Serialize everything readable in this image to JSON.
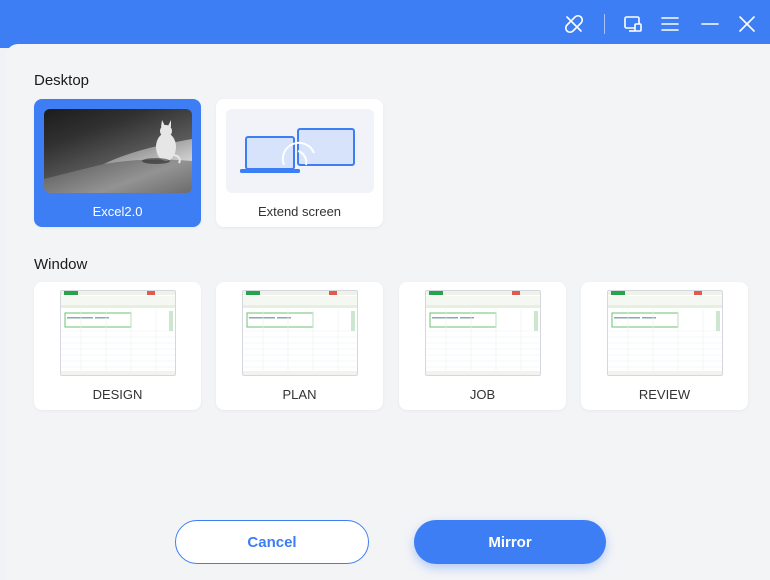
{
  "window": {
    "title_icons": [
      "disconnect-icon",
      "screen-cast-icon",
      "menu-icon",
      "minimize-icon",
      "close-icon"
    ],
    "accent": "#3d7ef5"
  },
  "desktop": {
    "label": "Desktop",
    "items": [
      {
        "label": "Excel2.0",
        "thumbnail": "cat-photo",
        "selected": true
      },
      {
        "label": "Extend screen",
        "thumbnail": "extend-screen",
        "selected": false
      }
    ]
  },
  "window_section": {
    "label": "Window",
    "items": [
      {
        "label": "DESIGN"
      },
      {
        "label": "PLAN"
      },
      {
        "label": "JOB"
      },
      {
        "label": "REVIEW"
      }
    ]
  },
  "actions": {
    "cancel_label": "Cancel",
    "mirror_label": "Mirror"
  }
}
